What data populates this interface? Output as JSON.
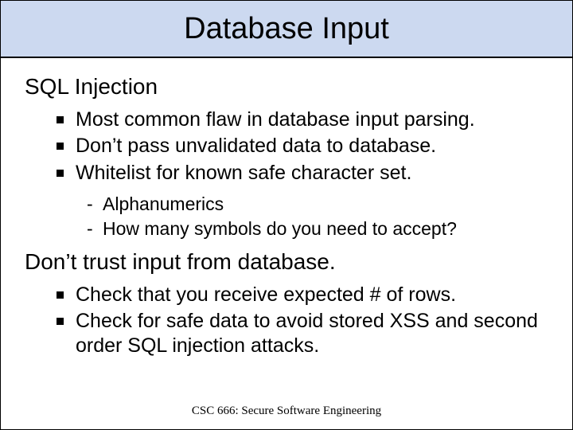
{
  "title": "Database Input",
  "section1": {
    "heading": "SQL Injection",
    "bullets": [
      "Most common flaw in database input parsing.",
      "Don’t pass unvalidated data to database.",
      "Whitelist for known safe character set."
    ],
    "sub": [
      "Alphanumerics",
      "How many symbols do you need to accept?"
    ]
  },
  "section2": {
    "heading": "Don’t trust input from database.",
    "bullets": [
      "Check that you receive expected # of rows.",
      "Check for safe data to avoid stored XSS and second order SQL injection attacks."
    ]
  },
  "footer": "CSC 666: Secure Software Engineering"
}
